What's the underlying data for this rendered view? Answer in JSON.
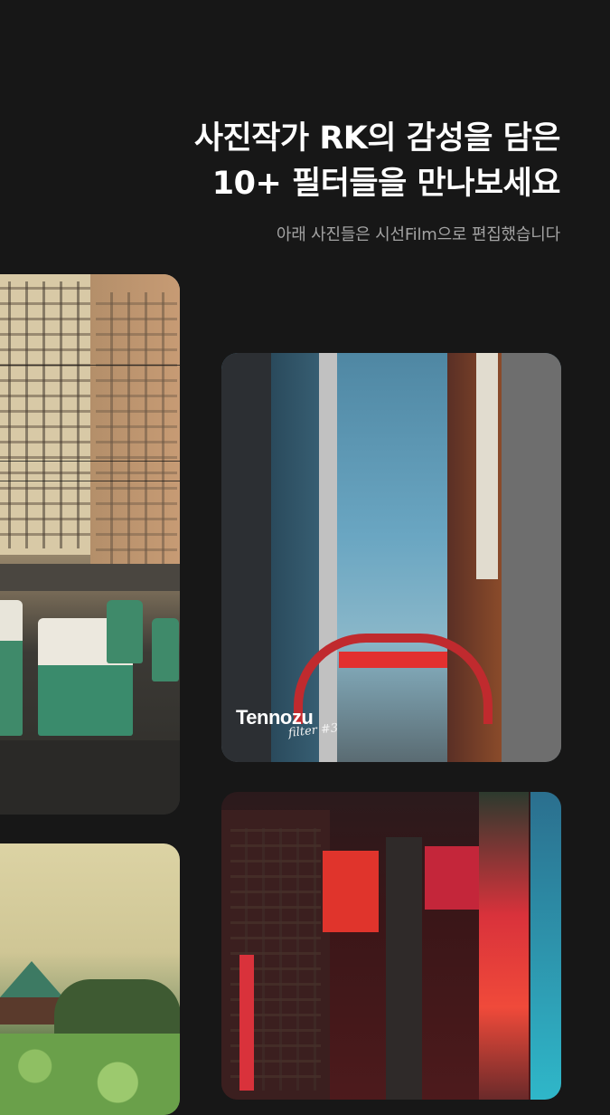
{
  "headline": {
    "line1": "사진작가 RK의 감성을 담은",
    "line2": "10+ 필터들을 만나보세요"
  },
  "subtitle": "아래 사진들은 시선Film으로 편집했습니다",
  "photos": [
    {
      "id": "apartments",
      "description_icon": "photo-apartment-buses"
    },
    {
      "id": "street",
      "description_icon": "photo-kabukicho-gate",
      "filter_name": "Tennozu",
      "filter_sub": "filter #3"
    },
    {
      "id": "pavilion",
      "description_icon": "photo-pavilion-lotus"
    },
    {
      "id": "night",
      "description_icon": "photo-night-city"
    }
  ],
  "colors": {
    "background": "#171717",
    "headline": "#ffffff",
    "subtitle": "#a3a3a3"
  }
}
